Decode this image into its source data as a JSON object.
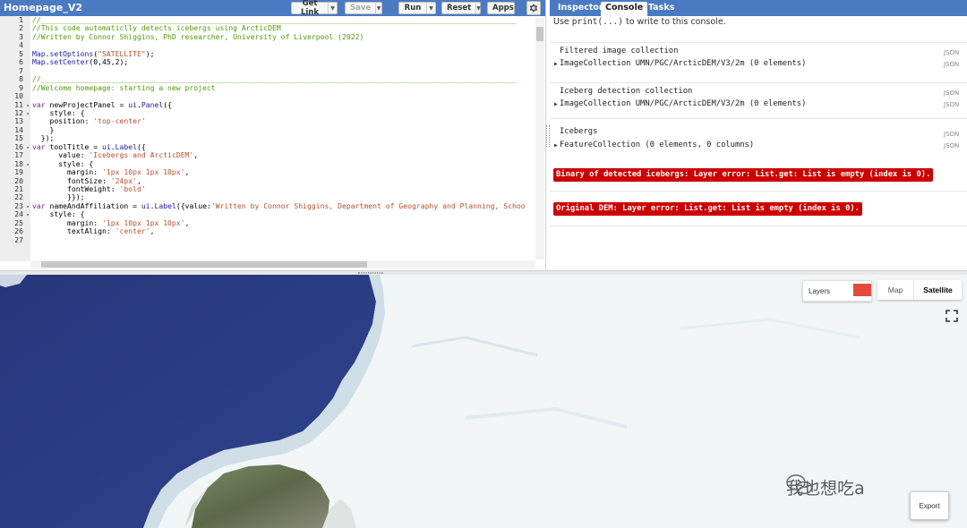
{
  "editor": {
    "title": "Homepage_V2",
    "toolbar": {
      "get_link": "Get Link",
      "save": "Save",
      "run": "Run",
      "reset": "Reset",
      "apps": "Apps"
    },
    "lines": [
      {
        "n": "1",
        "fold": false,
        "html": "<span class=\"cm\">//_____________________________________________________________________________________________________________</span>"
      },
      {
        "n": "2",
        "fold": false,
        "html": "<span class=\"cm\">//This code automaticlly detects icebergs using ArcticDEM</span>"
      },
      {
        "n": "3",
        "fold": false,
        "html": "<span class=\"cm\">//Written by Connor Shiggins, PhD researcher, University of Liverpool (2022)</span>"
      },
      {
        "n": "4",
        "fold": false,
        "html": ""
      },
      {
        "n": "5",
        "fold": false,
        "html": "<span class=\"fn\">Map</span>.<span class=\"fn\">setOptions</span>(<span class=\"str\">\"SATELLITE\"</span>);"
      },
      {
        "n": "6",
        "fold": false,
        "html": "<span class=\"fn\">Map</span>.<span class=\"fn\">setCenter</span>(0,45,2);"
      },
      {
        "n": "7",
        "fold": false,
        "html": ""
      },
      {
        "n": "8",
        "fold": false,
        "html": "<span class=\"cm\">//_____________________________________________________________________________________________________________</span>"
      },
      {
        "n": "9",
        "fold": false,
        "html": "<span class=\"cm\">//Welcome homepage: starting a new project</span>"
      },
      {
        "n": "10",
        "fold": false,
        "html": ""
      },
      {
        "n": "11",
        "fold": true,
        "html": "<span class=\"kw\">var</span> newProjectPanel = <span class=\"fn\">ui</span>.<span class=\"fn\">Panel</span>({"
      },
      {
        "n": "12",
        "fold": true,
        "html": "    style: {"
      },
      {
        "n": "13",
        "fold": false,
        "html": "    position: <span class=\"str\">'top-center'</span>"
      },
      {
        "n": "14",
        "fold": false,
        "html": "    }"
      },
      {
        "n": "15",
        "fold": false,
        "html": "  });"
      },
      {
        "n": "16",
        "fold": true,
        "html": "<span class=\"kw\">var</span> toolTitle = <span class=\"fn\">ui</span>.<span class=\"fn\">Label</span>({"
      },
      {
        "n": "17",
        "fold": false,
        "html": "      value: <span class=\"str\">'Icebergs and ArcticDEM'</span>,"
      },
      {
        "n": "18",
        "fold": true,
        "html": "      style: {"
      },
      {
        "n": "19",
        "fold": false,
        "html": "        margin: <span class=\"str\">'1px 10px 1px 10px'</span>,"
      },
      {
        "n": "20",
        "fold": false,
        "html": "        fontSize: <span class=\"str\">'24px'</span>,"
      },
      {
        "n": "21",
        "fold": false,
        "html": "        fontWeight: <span class=\"str\">'bold'</span>"
      },
      {
        "n": "22",
        "fold": false,
        "html": "        }});"
      },
      {
        "n": "23",
        "fold": true,
        "html": "<span class=\"kw\">var</span> nameAndAffiliation = <span class=\"fn\">ui</span>.<span class=\"fn\">Label</span>({value:<span class=\"str\">'Written by Connor Shiggins, Department of Geography and Planning, Schoo</span>"
      },
      {
        "n": "24",
        "fold": true,
        "html": "    style: {"
      },
      {
        "n": "25",
        "fold": false,
        "html": "        margin: <span class=\"str\">'1px 10px 1px 10px'</span>,"
      },
      {
        "n": "26",
        "fold": false,
        "html": "        textAlign: <span class=\"str\">'center'</span>,"
      },
      {
        "n": "27",
        "fold": false,
        "html": ""
      }
    ]
  },
  "console": {
    "tabs": [
      "Inspector",
      "Console",
      "Tasks"
    ],
    "hint_prefix": "Use ",
    "hint_code": "print(...)",
    "hint_suffix": " to write to this console.",
    "json_label": "JSON",
    "entries": [
      {
        "title": "Filtered image collection",
        "row": "ImageCollection UMN/PGC/ArcticDEM/V3/2m (0 elements)"
      },
      {
        "title": "Iceberg detection collection",
        "row": "ImageCollection UMN/PGC/ArcticDEM/V3/2m (0 elements)"
      },
      {
        "title": "Icebergs",
        "row": "FeatureCollection (0 elements, 0 columns)"
      }
    ],
    "errors": [
      "Binary of detected icebergs: Layer error: List.get: List is empty (index is 0).",
      "Original DEM: Layer error: List.get: List is empty (index is 0)."
    ]
  },
  "map": {
    "layers_label": "Layers",
    "layer_color": "#e14a3c",
    "map_type_options": [
      "Map",
      "Satellite"
    ],
    "selected_map_type": "Satellite",
    "export_label": "Export",
    "watermark_text": "我也想吃a"
  },
  "icons": {
    "gear": "gear-icon",
    "fullscreen": "fullscreen-icon",
    "dropdown": "chevron-down-icon",
    "expand": "triangle-right-icon",
    "watermark": "wechat-icon"
  }
}
